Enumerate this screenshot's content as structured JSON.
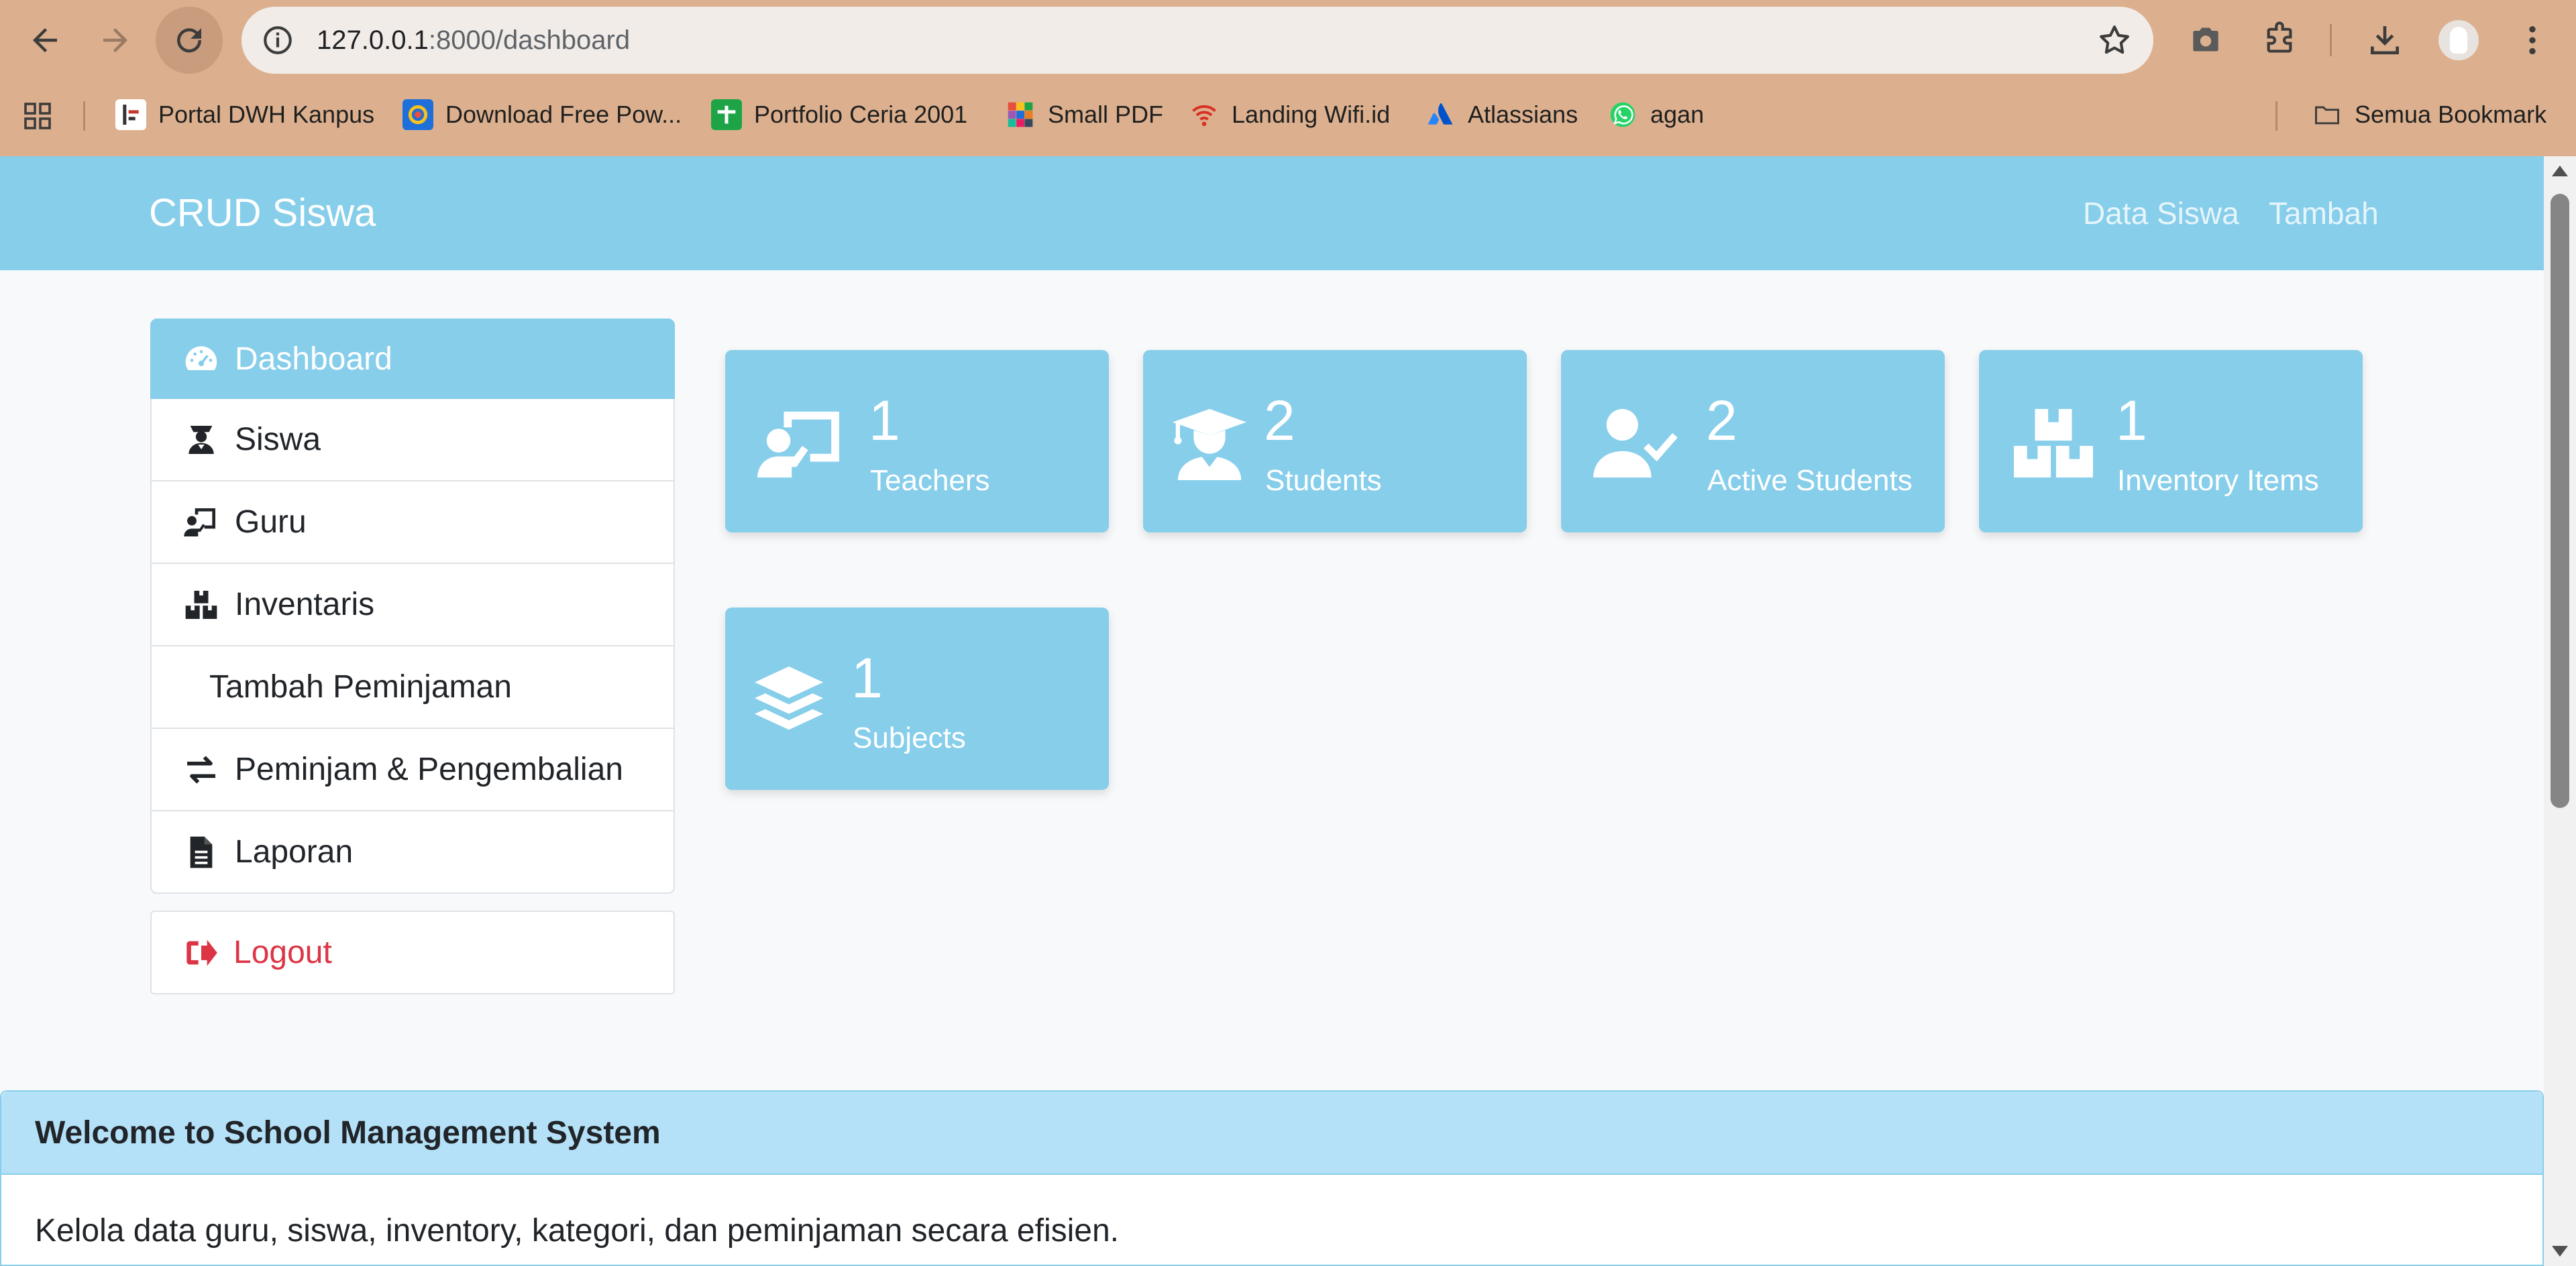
{
  "browser": {
    "url_host": "127.0.0.1",
    "url_path": ":8000/dashboard",
    "bookmarks": [
      {
        "label": "Portal DWH Kanpus",
        "icon": "portal-favicon",
        "color": "#ffffff"
      },
      {
        "label": "Download Free Pow...",
        "icon": "download-favicon",
        "color": "#1e6fd9"
      },
      {
        "label": "Portfolio Ceria 2001",
        "icon": "portfolio-favicon",
        "color": "#1ea446"
      },
      {
        "label": "Small PDF",
        "icon": "smallpdf-favicon",
        "color": "#e94e3d"
      },
      {
        "label": "Landing Wifi.id",
        "icon": "wifi-favicon",
        "color": "#d93025"
      },
      {
        "label": "Atlassians",
        "icon": "atlassian-favicon",
        "color": "#2684ff"
      },
      {
        "label": "agan",
        "icon": "whatsapp-favicon",
        "color": "#25d366"
      }
    ],
    "all_bookmarks": "Semua Bookmark"
  },
  "navbar": {
    "brand": "CRUD Siswa",
    "links": [
      "Data Siswa",
      "Tambah"
    ]
  },
  "sidebar": {
    "items": [
      {
        "label": "Dashboard",
        "icon": "dashboard-icon",
        "active": true
      },
      {
        "label": "Siswa",
        "icon": "student-icon"
      },
      {
        "label": "Guru",
        "icon": "teacher-icon"
      },
      {
        "label": "Inventaris",
        "icon": "boxes-icon"
      },
      {
        "label": "Tambah Peminjaman",
        "icon": ""
      },
      {
        "label": "Peminjam & Pengembalian",
        "icon": "exchange-icon"
      },
      {
        "label": "Laporan",
        "icon": "document-icon"
      }
    ],
    "logout": "Logout"
  },
  "cards": [
    {
      "value": "1",
      "label": "Teachers",
      "icon": "teacher-icon"
    },
    {
      "value": "2",
      "label": "Students",
      "icon": "graduate-icon"
    },
    {
      "value": "2",
      "label": "Active Students",
      "icon": "user-check-icon"
    },
    {
      "value": "1",
      "label": "Inventory Items",
      "icon": "boxes-icon"
    },
    {
      "value": "1",
      "label": "Subjects",
      "icon": "layers-icon"
    }
  ],
  "welcome": {
    "title": "Welcome to School Management System",
    "text": "Kelola data guru, siswa, inventory, kategori, dan peminjaman secara efisien."
  },
  "colors": {
    "accent": "#87ceeb",
    "chrome": "#dcb08e",
    "danger": "#dc3545"
  }
}
